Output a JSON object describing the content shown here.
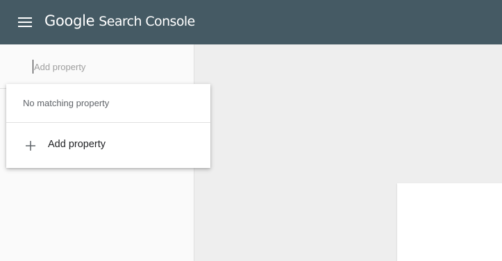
{
  "header": {
    "brand_google": "Google",
    "brand_product": "Search Console",
    "menu_icon": "hamburger-menu-icon",
    "background": "#455a64"
  },
  "property_picker": {
    "placeholder": "Add property",
    "value": ""
  },
  "dropdown": {
    "empty_message": "No matching property",
    "add_label": "Add property",
    "add_icon": "plus-icon"
  }
}
